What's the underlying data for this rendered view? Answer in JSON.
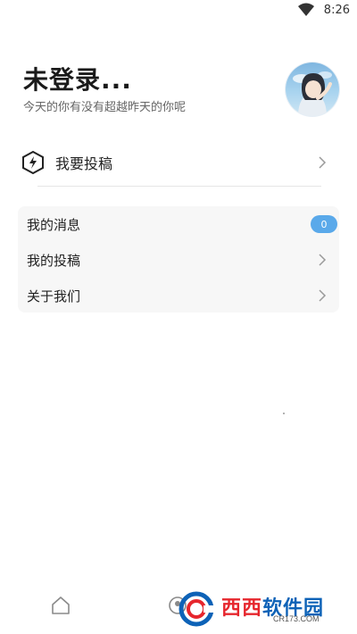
{
  "status_bar": {
    "time": "8:26"
  },
  "header": {
    "title": "未登录...",
    "subtitle": "今天的你有没有超越昨天的你呢"
  },
  "submit": {
    "label": "我要投稿",
    "icon": "bolt-hexagon-icon"
  },
  "menu": {
    "items": [
      {
        "label": "我的消息",
        "badge": "0"
      },
      {
        "label": "我的投稿"
      },
      {
        "label": "关于我们"
      }
    ]
  },
  "bottom_nav": {
    "items": [
      {
        "icon": "home-icon"
      },
      {
        "icon": "profile-icon"
      }
    ]
  },
  "watermark": {
    "brand": "西西",
    "suffix": "软件园",
    "domain": "CR173.COM"
  },
  "colors": {
    "accent": "#5aa9ea",
    "card_bg": "#f7f7f7",
    "watermark_red": "#e6262d",
    "watermark_blue": "#0d62b7"
  }
}
